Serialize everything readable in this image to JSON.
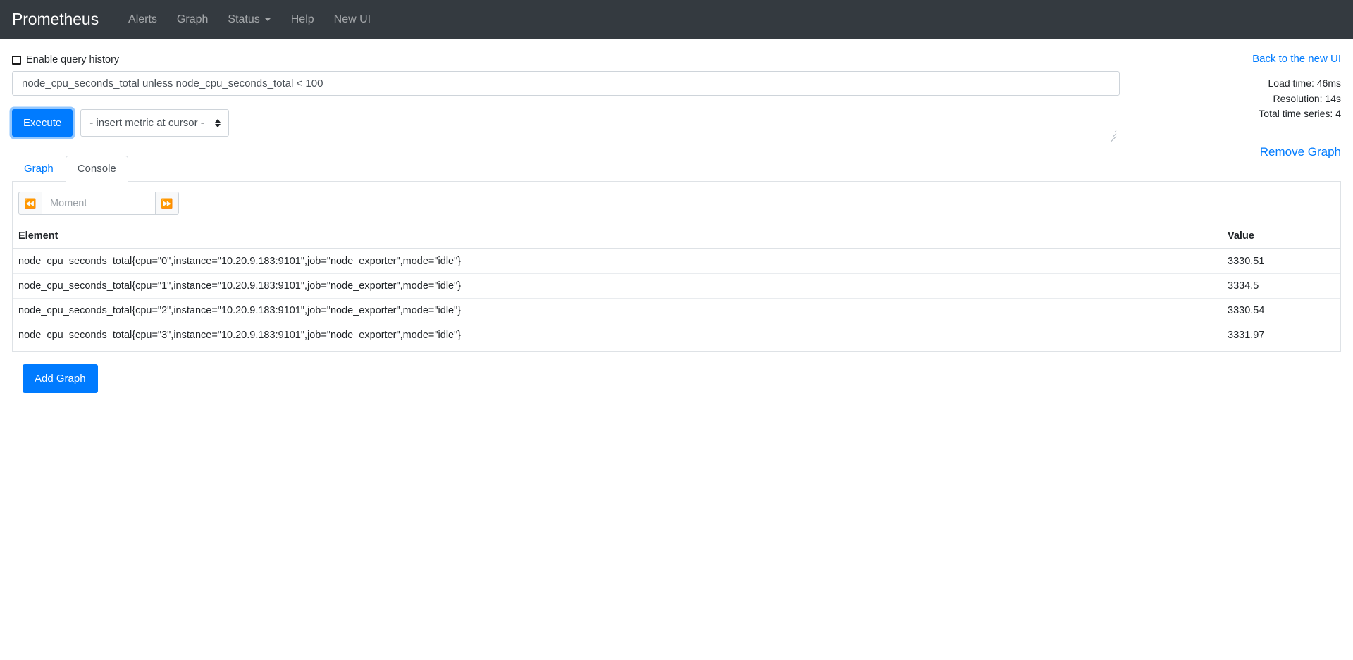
{
  "navbar": {
    "brand": "Prometheus",
    "items": [
      {
        "label": "Alerts",
        "has_caret": false
      },
      {
        "label": "Graph",
        "has_caret": false
      },
      {
        "label": "Status",
        "has_caret": true
      },
      {
        "label": "Help",
        "has_caret": false
      },
      {
        "label": "New UI",
        "has_caret": false
      }
    ]
  },
  "right_panel": {
    "back_link": "Back to the new UI",
    "load_time": "Load time: 46ms",
    "resolution": "Resolution: 14s",
    "total_series": "Total time series: 4",
    "remove_graph": "Remove Graph"
  },
  "query": {
    "history_label": "Enable query history",
    "history_checked": false,
    "expression": "node_cpu_seconds_total unless node_cpu_seconds_total < 100",
    "execute_label": "Execute",
    "metric_select_value": "- insert metric at cursor -"
  },
  "tabs": [
    {
      "label": "Graph",
      "active": false
    },
    {
      "label": "Console",
      "active": true
    }
  ],
  "moment_bar": {
    "prev_icon": "⏪",
    "next_icon": "⏩",
    "placeholder": "Moment",
    "value": ""
  },
  "table": {
    "headers": {
      "element": "Element",
      "value": "Value"
    },
    "rows": [
      {
        "element": "node_cpu_seconds_total{cpu=\"0\",instance=\"10.20.9.183:9101\",job=\"node_exporter\",mode=\"idle\"}",
        "value": "3330.51"
      },
      {
        "element": "node_cpu_seconds_total{cpu=\"1\",instance=\"10.20.9.183:9101\",job=\"node_exporter\",mode=\"idle\"}",
        "value": "3334.5"
      },
      {
        "element": "node_cpu_seconds_total{cpu=\"2\",instance=\"10.20.9.183:9101\",job=\"node_exporter\",mode=\"idle\"}",
        "value": "3330.54"
      },
      {
        "element": "node_cpu_seconds_total{cpu=\"3\",instance=\"10.20.9.183:9101\",job=\"node_exporter\",mode=\"idle\"}",
        "value": "3331.97"
      }
    ]
  },
  "add_graph_label": "Add Graph",
  "colors": {
    "navbar_bg": "#343a40",
    "primary": "#007bff",
    "border": "#dee2e6",
    "text": "#212529"
  }
}
